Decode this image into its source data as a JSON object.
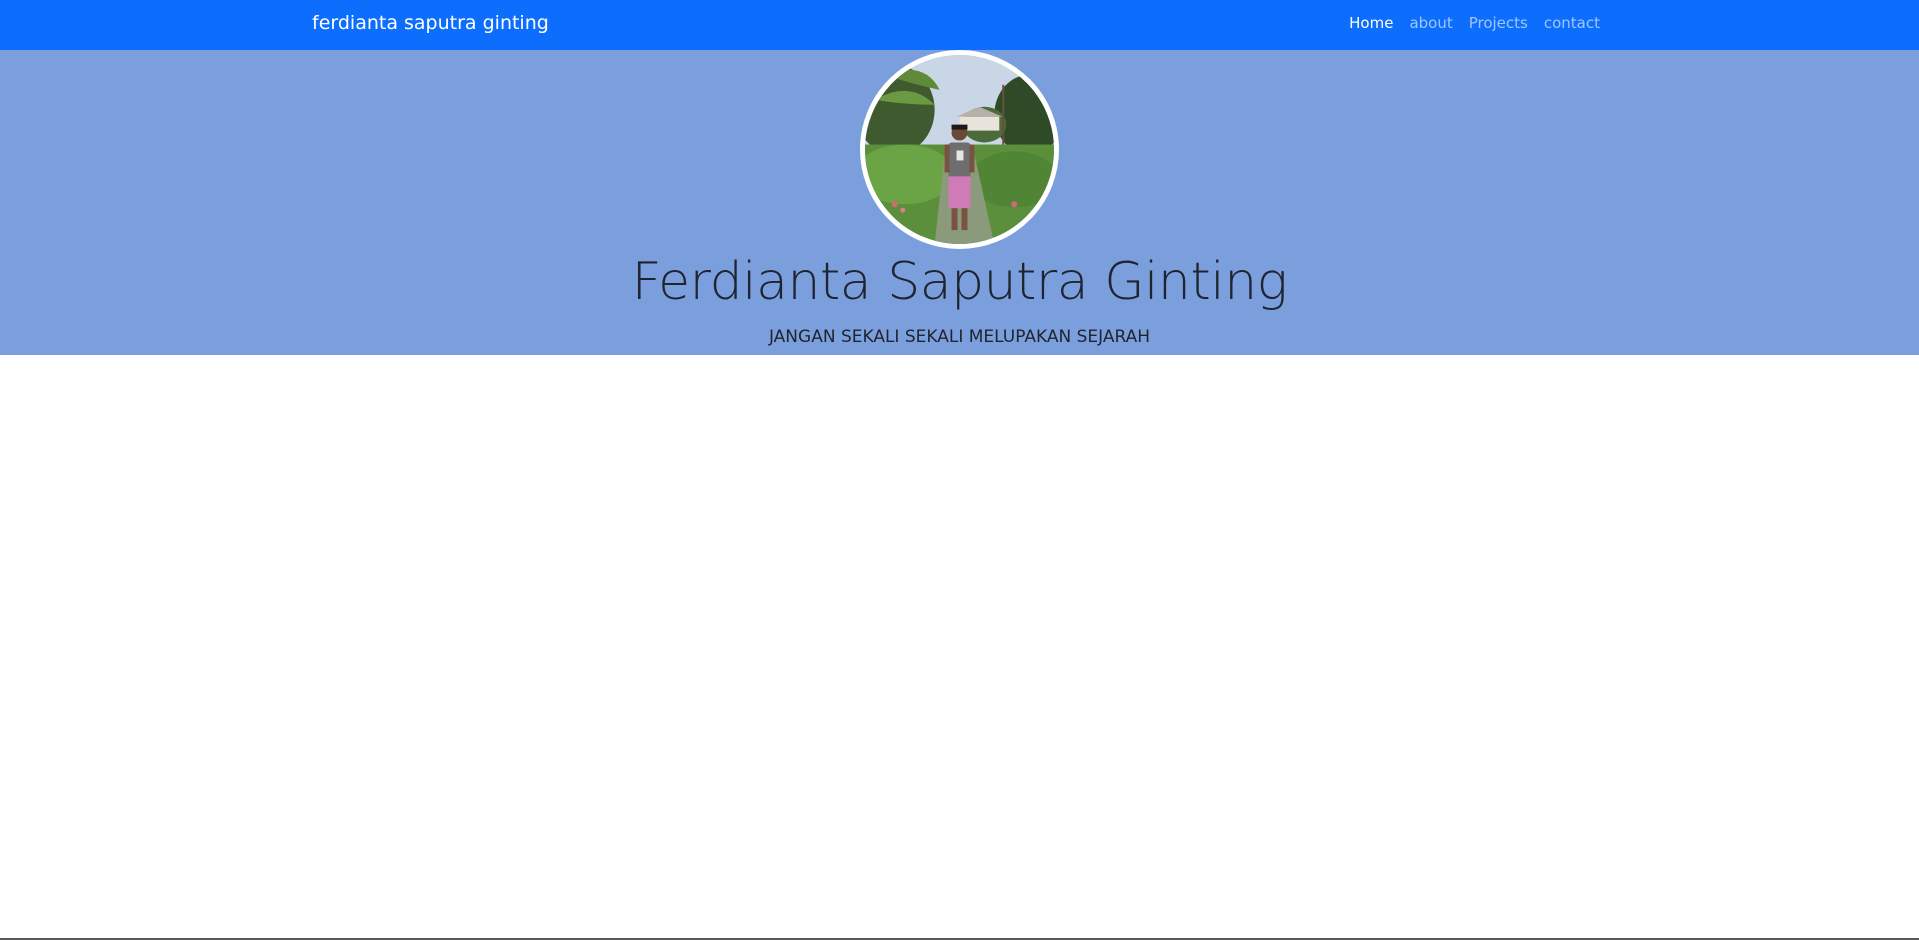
{
  "navbar": {
    "brand": "ferdianta saputra ginting",
    "links": [
      {
        "label": "Home",
        "active": true
      },
      {
        "label": "about",
        "active": false
      },
      {
        "label": "Projects",
        "active": false
      },
      {
        "label": "contact",
        "active": false
      }
    ]
  },
  "hero": {
    "name": "Ferdianta Saputra Ginting",
    "tagline": "JANGAN SEKALI SEKALI MELUPAKAN SEJARAH"
  },
  "colors": {
    "navbar_bg": "#0d6efd",
    "hero_bg": "#7b9fdc"
  }
}
